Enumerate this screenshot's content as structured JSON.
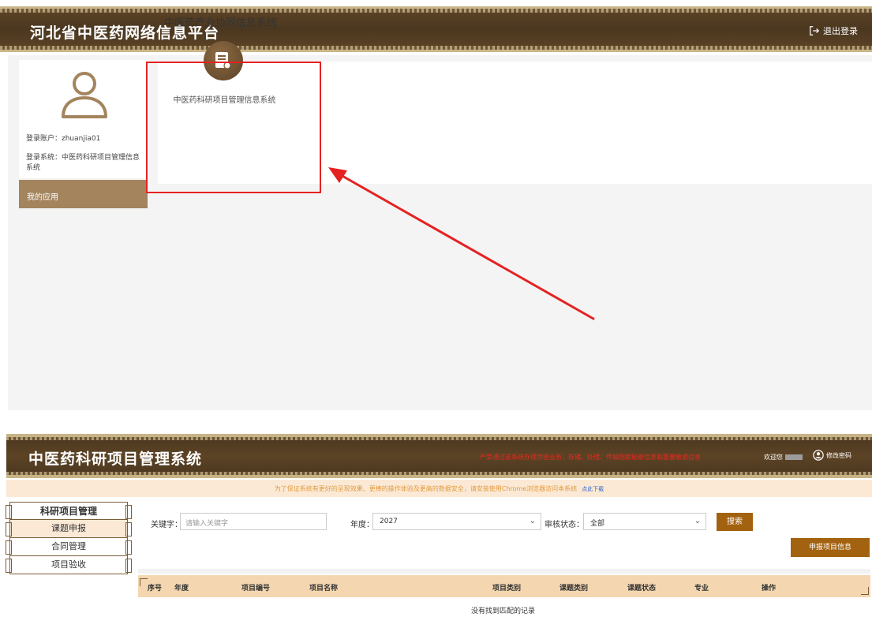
{
  "screen1": {
    "header": {
      "title": "河北省中医药网络信息平台",
      "logout_label": "退出登录"
    },
    "user": {
      "account_line": "登录账户：zhuanjia01",
      "system_line": "登录系统：中医药科研项目管理信息系统",
      "my_apps_label": "我的应用"
    },
    "apps_section": {
      "title": "中医药产业协同信息系统",
      "app_name": "中医药科研项目管理信息系统",
      "icon": "document-icon"
    },
    "annotation": {
      "highlight_color": "#e52222"
    }
  },
  "screen2": {
    "header": {
      "title": "中医药科研项目管理系统",
      "warning": "严禁通过该系统办理涉密业务，存储、处理、传输国家秘密信息和重要敏感信息",
      "welcome": "欢迎您",
      "change_password": "修改密码"
    },
    "notice": {
      "text": "为了保证系统有更好的呈现效果、更棒的操作体验及更高的数据安全，请安装使用Chrome浏览器访问本系统",
      "download_link": "点此下载"
    },
    "sidebar": {
      "title": "科研项目管理",
      "items": [
        "课题申报",
        "合同管理",
        "项目验收"
      ],
      "active_index": 0
    },
    "filters": {
      "keyword_label": "关键字：",
      "keyword_placeholder": "请输入关键字",
      "year_label": "年度：",
      "year_value": "2027",
      "status_label": "审核状态：",
      "status_value": "全部",
      "search_button": "搜索"
    },
    "apply_button": "申报项目信息",
    "table": {
      "columns": [
        "序号",
        "年度",
        "项目编号",
        "项目名称",
        "项目类别",
        "课题类别",
        "课题状态",
        "专业",
        "操作"
      ],
      "empty_text": "没有找到匹配的记录"
    },
    "colors": {
      "brand_brown": "#5c4325",
      "button": "#a3620f",
      "table_header": "#f4d7b0",
      "warning": "#e8281c"
    }
  }
}
